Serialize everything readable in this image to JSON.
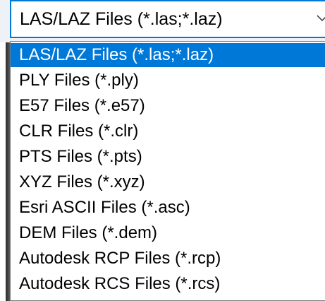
{
  "combo": {
    "value": "LAS/LAZ Files (*.las;*.laz)",
    "arrow_icon": "chevron-down-icon"
  },
  "dropdown": {
    "selected_index": 0,
    "highlight_color": "#0078d7",
    "options": [
      "LAS/LAZ Files (*.las;*.laz)",
      "PLY Files (*.ply)",
      "E57 Files (*.e57)",
      "CLR Files (*.clr)",
      "PTS Files (*.pts)",
      "XYZ Files (*.xyz)",
      "Esri ASCII Files (*.asc)",
      "DEM Files (*.dem)",
      "Autodesk RCP Files (*.rcp)",
      "Autodesk RCS Files (*.rcs)"
    ]
  }
}
